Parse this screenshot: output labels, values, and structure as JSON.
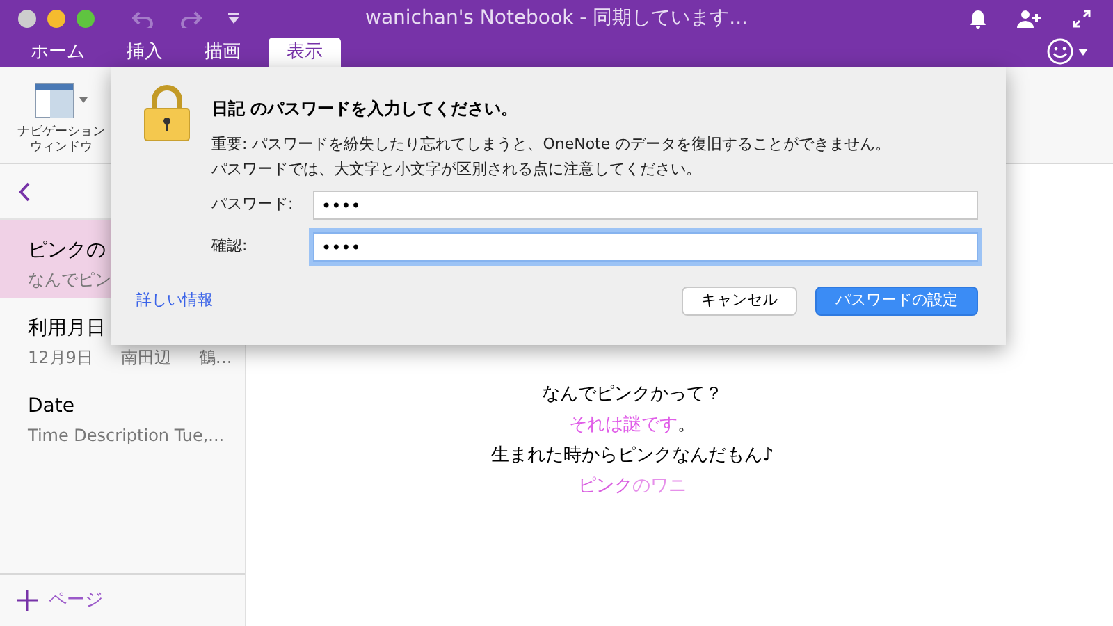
{
  "window": {
    "title": "wanichan's Notebook - 同期しています..."
  },
  "tabs": [
    {
      "label": "ホーム",
      "selected": false
    },
    {
      "label": "挿入",
      "selected": false
    },
    {
      "label": "描画",
      "selected": false
    },
    {
      "label": "表示",
      "selected": true
    }
  ],
  "ribbon": {
    "items": [
      {
        "label": [
          "ナビゲーション",
          "ウィンドウ"
        ]
      }
    ]
  },
  "sidebar": {
    "pages": [
      {
        "title": "ピンクの",
        "preview": [
          "なんでピン"
        ],
        "selected": true
      },
      {
        "title": "利用月日",
        "preview": [
          "12月9日",
          "南田辺",
          "鶴…"
        ],
        "selected": false
      },
      {
        "title": "Date",
        "preview": [
          "Time  Description  Tue,..."
        ],
        "selected": false
      }
    ],
    "add_page": "ページ"
  },
  "note": {
    "lines": [
      [
        {
          "text": "なんでピンクかって？"
        }
      ],
      [
        {
          "text": "それは謎です",
          "color": "#e05ee8"
        },
        {
          "text": "。"
        }
      ],
      [
        {
          "text": "生まれた時からピンクなんだもん♪"
        }
      ],
      [
        {
          "text": "ピンク",
          "color": "#d95ee0"
        },
        {
          "text": "のワニ",
          "color": "#e690ea"
        }
      ]
    ]
  },
  "dialog": {
    "title": "日記 のパスワードを入力してください。",
    "message": [
      "重要: パスワードを紛失したり忘れてしまうと、OneNote のデータを復旧することができません。",
      "パスワードでは、大文字と小文字が区別される点に注意してください。"
    ],
    "fields": [
      {
        "label": "パスワード:",
        "value": "••••",
        "focused": false
      },
      {
        "label": "確認:",
        "value": "••••",
        "focused": true
      }
    ],
    "link": "詳しい情報",
    "buttons": [
      {
        "label": "キャンセル",
        "default": false
      },
      {
        "label": "パスワードの設定",
        "default": true
      }
    ]
  }
}
